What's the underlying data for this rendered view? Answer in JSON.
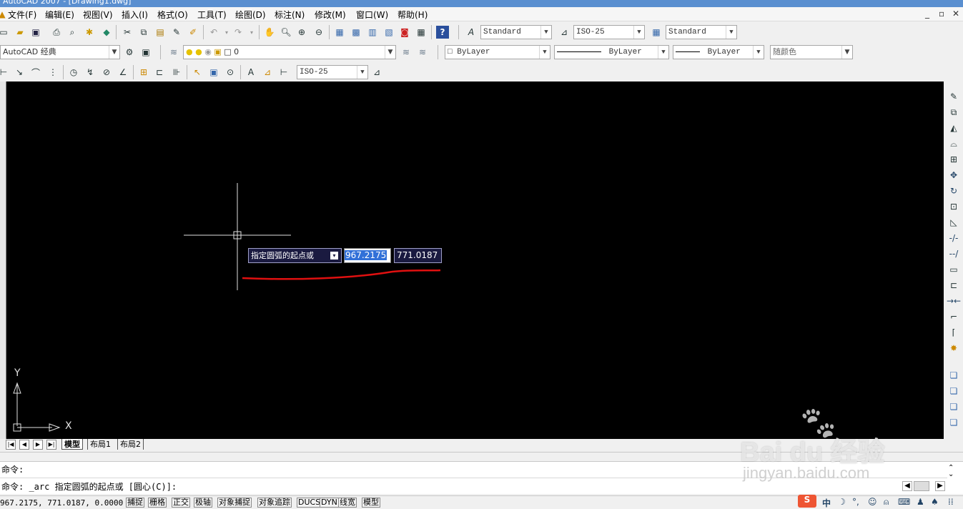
{
  "window": {
    "title": "AutoCAD 2007 - [Drawing1.dwg]"
  },
  "menu": [
    "文件(F)",
    "编辑(E)",
    "视图(V)",
    "插入(I)",
    "格式(O)",
    "工具(T)",
    "绘图(D)",
    "标注(N)",
    "修改(M)",
    "窗口(W)",
    "帮助(H)"
  ],
  "toolbar1": {
    "text_style": "Standard",
    "dim_style": "ISO-25",
    "table_style": "Standard"
  },
  "toolbar2": {
    "workspace": "AutoCAD 经典",
    "layer": "0",
    "color": "ByLayer",
    "linetype": "ByLayer",
    "lineweight": "ByLayer",
    "plot_style": "随颜色"
  },
  "toolbar3": {
    "dim_style": "ISO-25"
  },
  "dynamic_input": {
    "prompt": "指定圆弧的起点或",
    "x_value": "967.2175",
    "y_value": "771.0187"
  },
  "ucs": {
    "y_label": "Y",
    "x_label": "X"
  },
  "layout_tabs": [
    "模型",
    "布局1",
    "布局2"
  ],
  "command": {
    "line1": "命令:",
    "line2": "命令: _arc 指定圆弧的起点或 [圆心(C)]:"
  },
  "status": {
    "coordinates": "967.2175, 771.0187, 0.0000",
    "buttons": [
      "捕捉",
      "栅格",
      "正交",
      "极轴",
      "对象捕捉",
      "对象追踪",
      "DUCS",
      "DYN",
      "线宽",
      "模型"
    ]
  },
  "watermark": {
    "brand": "Bai du 经验",
    "url": "jingyan.baidu.com"
  },
  "colors": {
    "canvas": "#000000",
    "highlight": "#3170d8",
    "annotation": "#e01010"
  }
}
